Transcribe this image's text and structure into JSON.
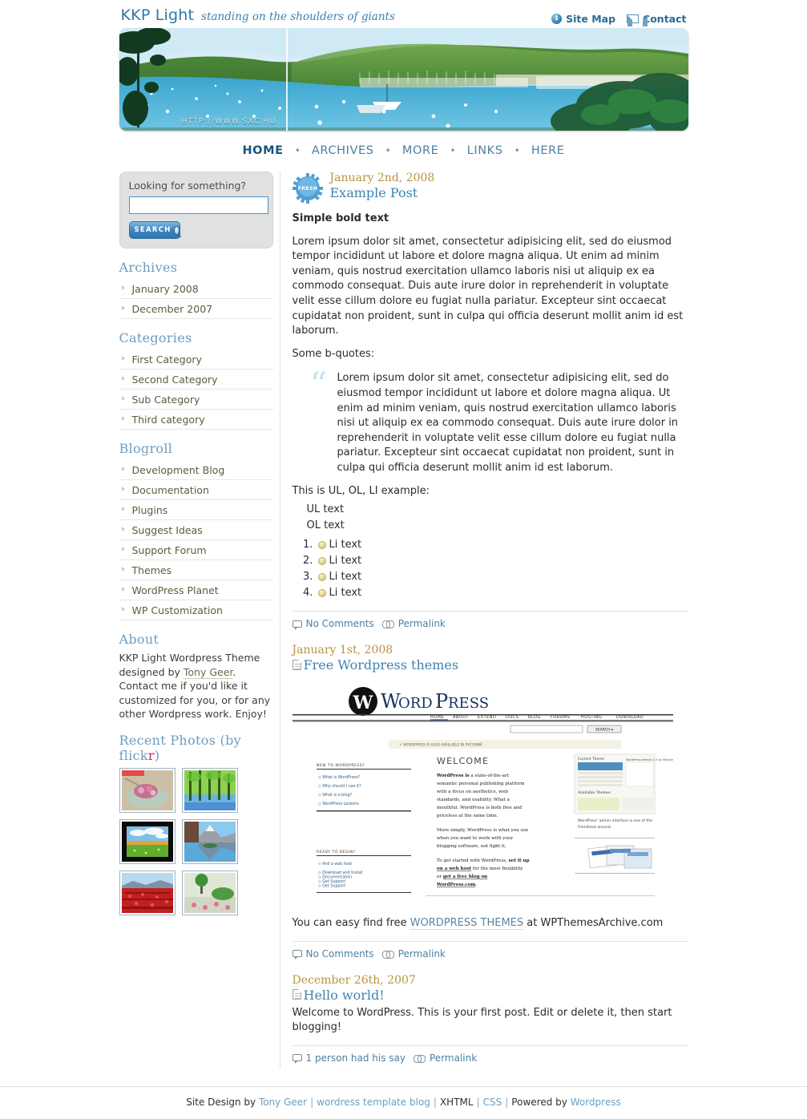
{
  "header": {
    "brand": "KKP Light",
    "tagline": "standing on the shoulders of giants",
    "top_links": [
      {
        "label": "Site Map",
        "icon": "info-icon"
      },
      {
        "label": "Contact",
        "icon": "mail-icon"
      }
    ],
    "banner_watermark": "HTTP://WWW.SXC.HU"
  },
  "nav": {
    "items": [
      {
        "label": "HOME",
        "active": true
      },
      {
        "label": "ARCHIVES",
        "active": false
      },
      {
        "label": "MORE",
        "active": false
      },
      {
        "label": "LINKS",
        "active": false
      },
      {
        "label": "HERE",
        "active": false
      }
    ],
    "separator": "•"
  },
  "search": {
    "label": "Looking for something?",
    "value": "",
    "placeholder": "",
    "button_label": "SEARCH"
  },
  "sidebar": {
    "widgets": [
      {
        "title": "Archives",
        "items": [
          "January 2008",
          "December 2007"
        ]
      },
      {
        "title": "Categories",
        "items": [
          "First Category",
          "Second Category",
          "Sub Category",
          "Third category"
        ]
      },
      {
        "title": "Blogroll",
        "items": [
          "Development Blog",
          "Documentation",
          "Plugins",
          "Suggest Ideas",
          "Support Forum",
          "Themes",
          "WordPress Planet",
          "WP Customization"
        ]
      }
    ],
    "about": {
      "title": "About",
      "text_before": "KKP Light Wordpress Theme designed by ",
      "link": "Tony Geer",
      "text_after": ". Contact me if you'd like it customized for you, or for any other Wordpress work. Enjoy!"
    },
    "photos": {
      "title_before": "Recent Photos (by flick",
      "title_accent": "r",
      "title_after": ")",
      "count": 6,
      "captions": [
        "pink-flowers-in-bowl",
        "green-forest-path",
        "field-under-clouds",
        "mountain-lake-reflection",
        "red-tulip-field",
        "garden-with-topiary"
      ]
    }
  },
  "posts": [
    {
      "badge": "FRESH",
      "date": "January 2nd, 2008",
      "title": "Example Post",
      "has_page_icon": false,
      "lead": "Simple bold text",
      "paragraphs": [
        "Lorem ipsum dolor sit amet, consectetur adipisicing elit, sed do eiusmod tempor incididunt ut labore et dolore magna aliqua. Ut enim ad minim veniam, quis nostrud exercitation ullamco laboris nisi ut aliquip ex ea commodo consequat. Duis aute irure dolor in reprehenderit in voluptate velit esse cillum dolore eu fugiat nulla pariatur. Excepteur sint occaecat cupidatat non proident, sunt in culpa qui officia deserunt mollit anim id est laborum.",
        "Some b-quotes:"
      ],
      "blockquote": "Lorem ipsum dolor sit amet, consectetur adipisicing elit, sed do eiusmod tempor incididunt ut labore et dolore magna aliqua. Ut enim ad minim veniam, quis nostrud exercitation ullamco laboris nisi ut aliquip ex ea commodo consequat. Duis aute irure dolor in reprehenderit in voluptate velit esse cillum dolore eu fugiat nulla pariatur. Excepteur sint occaecat cupidatat non proident, sunt in culpa qui officia deserunt mollit anim id est laborum.",
      "list_intro": "This is UL, OL, LI example:",
      "ul_items": [
        "UL text",
        "OL text"
      ],
      "ol_items": [
        "Li text",
        "Li text",
        "Li text",
        "Li text"
      ],
      "comments": "No Comments",
      "permalink": "Permalink"
    },
    {
      "date": "January 1st, 2008",
      "title": "Free Wordpress themes",
      "has_page_icon": true,
      "closing_before": "You can easy find free ",
      "closing_link": "WORDPRESS THEMES",
      "closing_after": " at WPThemesArchive.com",
      "comments": "No Comments",
      "permalink": "Permalink",
      "screenshot": {
        "logo": "WordPress",
        "nav": [
          "HOME",
          "ABOUT",
          "EXTEND",
          "DOCS",
          "BLOG",
          "FORUMS",
          "HOSTING",
          "DOWNLOAD"
        ],
        "search_button": "SEARCH",
        "notice": "WORDPRESS IS ALSO AVAILABLE IN РУССКИЙ.",
        "welcome_heading": "WELCOME",
        "welcome_lead": "WordPress is",
        "welcome_body": " a state-of-the-art semantic personal publishing platform with a focus on aesthetics, web standards, and usability. What a mouthful. WordPress is both free and priceless at the same time.",
        "welcome_body2": "More simply, WordPress is what you use when you want to work with your blogging software, not fight it.",
        "welcome_body3_before": "To get started with WordPress, ",
        "welcome_body3_link1": "set it up on a web host",
        "welcome_body3_mid": " for the most flexibility or ",
        "welcome_body3_link2": "get a free blog on WordPress.com",
        "welcome_body3_after": ".",
        "left_heading1": "NEW TO WORDPRESS?",
        "left_links1": [
          "What is WordPress?",
          "Why should I use it?",
          "What is a blog?",
          "WordPress Lessons"
        ],
        "left_heading2": "READY TO BEGIN?",
        "left_links2": [
          "find a web host",
          "Download and Install",
          "Documentation",
          "Get Support"
        ],
        "right_heading1": "Current Theme",
        "right_heading2": "Available Themes",
        "right_caption": "WordPress' admin interface is one of the friendliest around."
      }
    },
    {
      "date": "December 26th, 2007",
      "title": "Hello world!",
      "has_page_icon": true,
      "paragraphs": [
        "Welcome to WordPress. This is your first post. Edit or delete it, then start blogging!"
      ],
      "comments": "1 person had his say",
      "permalink": "Permalink"
    }
  ],
  "footer": {
    "design_by": "Site Design by",
    "designer": "Tony Geer",
    "template_blog": "wordress template blog",
    "xhtml": "XHTML",
    "css": "CSS",
    "powered_by": "Powered by",
    "platform": "Wordpress",
    "separator": "|"
  },
  "colors": {
    "brand_blue": "#2e77a8",
    "link_blue": "#4b7fa0",
    "date_gold": "#b99340",
    "heading_blue": "#6c9cc0",
    "flickr_red": "#d1265f"
  }
}
